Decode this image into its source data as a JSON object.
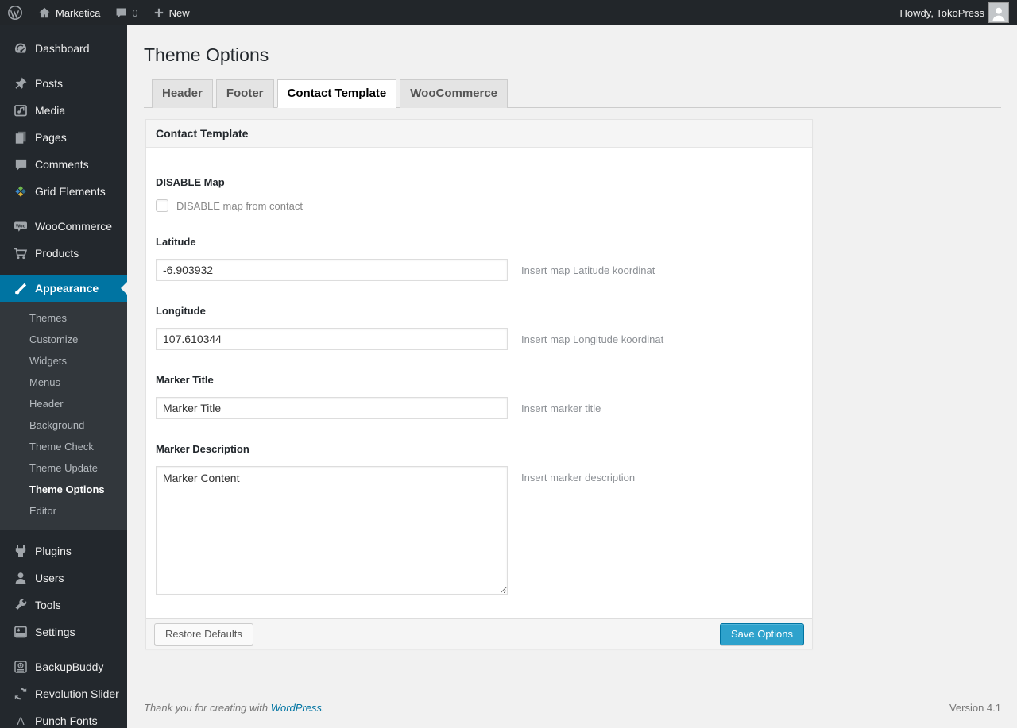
{
  "colors": {
    "accent": "#0074a2",
    "button_primary": "#2ea2cc",
    "menu_bg": "#23282d",
    "submenu_bg": "#32373c"
  },
  "admin_bar": {
    "site_name": "Marketica",
    "comment_count": "0",
    "new_label": "New",
    "howdy": "Howdy, TokoPress"
  },
  "sidebar": {
    "items": [
      {
        "label": "Dashboard",
        "icon": "dashboard-icon"
      },
      {
        "label": "Posts",
        "icon": "pushpin-icon"
      },
      {
        "label": "Media",
        "icon": "media-icon"
      },
      {
        "label": "Pages",
        "icon": "pages-icon"
      },
      {
        "label": "Comments",
        "icon": "comments-icon"
      },
      {
        "label": "Grid Elements",
        "icon": "grid-elements-icon"
      },
      {
        "label": "WooCommerce",
        "icon": "woocommerce-icon"
      },
      {
        "label": "Products",
        "icon": "cart-icon"
      },
      {
        "label": "Appearance",
        "icon": "brush-icon",
        "active": true
      },
      {
        "label": "Plugins",
        "icon": "plugin-icon"
      },
      {
        "label": "Users",
        "icon": "user-icon"
      },
      {
        "label": "Tools",
        "icon": "wrench-icon"
      },
      {
        "label": "Settings",
        "icon": "settings-icon"
      },
      {
        "label": "BackupBuddy",
        "icon": "backup-icon"
      },
      {
        "label": "Revolution Slider",
        "icon": "refresh-icon"
      },
      {
        "label": "Punch Fonts",
        "icon": "letter-a-icon"
      }
    ],
    "appearance_submenu": [
      "Themes",
      "Customize",
      "Widgets",
      "Menus",
      "Header",
      "Background",
      "Theme Check",
      "Theme Update",
      "Theme Options",
      "Editor"
    ],
    "current_submenu_item": "Theme Options"
  },
  "main": {
    "page_title": "Theme Options",
    "tabs": [
      {
        "label": "Header",
        "active": false
      },
      {
        "label": "Footer",
        "active": false
      },
      {
        "label": "Contact Template",
        "active": true
      },
      {
        "label": "WooCommerce",
        "active": false
      }
    ],
    "panel": {
      "title": "Contact Template",
      "fields": {
        "disable_map": {
          "label": "DISABLE Map",
          "checkbox_label": "DISABLE map from contact",
          "checked": false
        },
        "latitude": {
          "label": "Latitude",
          "value": "-6.903932",
          "helper": "Insert map Latitude koordinat"
        },
        "longitude": {
          "label": "Longitude",
          "value": "107.610344",
          "helper": "Insert map Longitude koordinat"
        },
        "marker_title": {
          "label": "Marker Title",
          "value": "Marker Title",
          "helper": "Insert marker title"
        },
        "marker_description": {
          "label": "Marker Description",
          "value": "Marker Content",
          "helper": "Insert marker description"
        }
      },
      "buttons": {
        "restore": "Restore Defaults",
        "save": "Save Options"
      }
    }
  },
  "footer": {
    "thanks_prefix": "Thank you for creating with ",
    "link_text": "WordPress",
    "thanks_suffix": ".",
    "version": "Version 4.1"
  }
}
